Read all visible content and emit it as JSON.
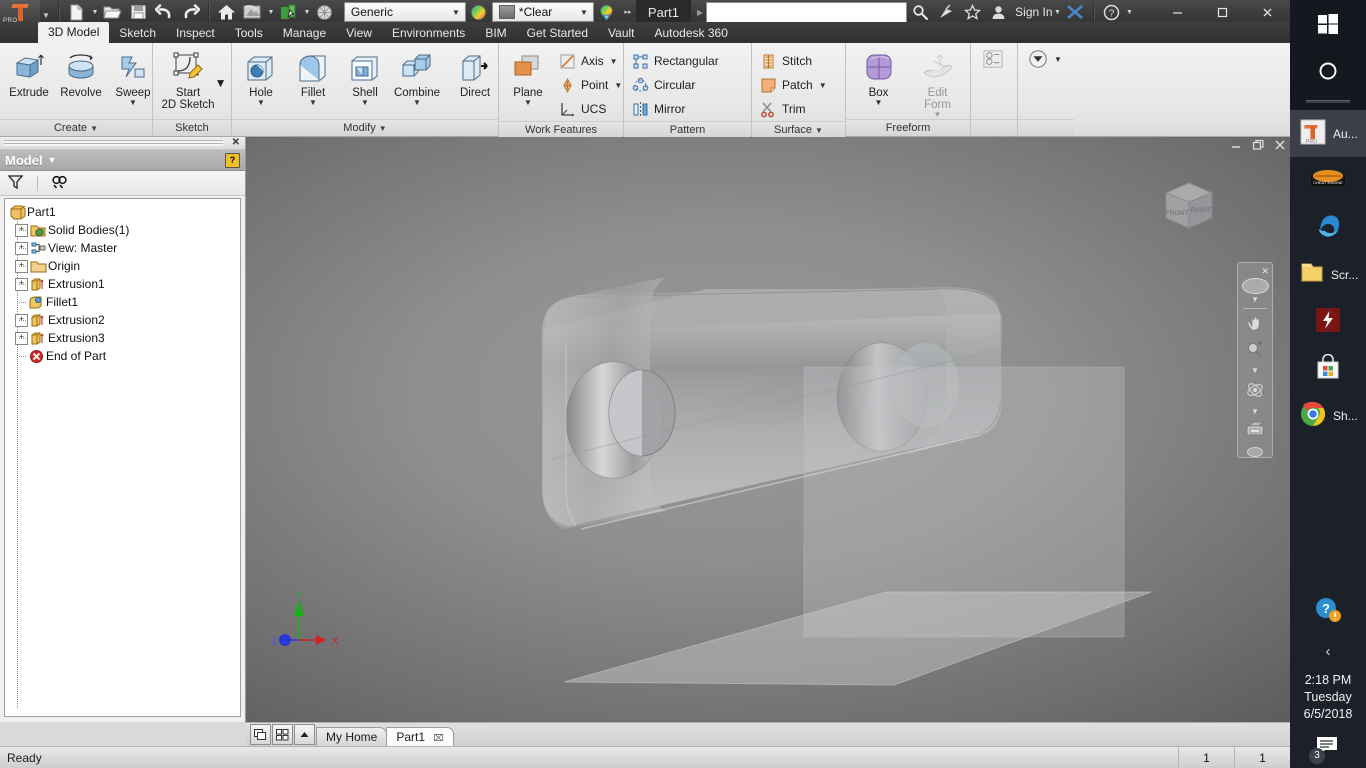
{
  "app": {
    "product": "Autodesk Inventor Professional",
    "document_title": "Part1",
    "pro_tag": "PRO"
  },
  "quick_access": {
    "items": [
      {
        "name": "new",
        "label": "New",
        "has_dropdown": true
      },
      {
        "name": "open",
        "label": "Open",
        "has_dropdown": false
      },
      {
        "name": "save",
        "label": "Save",
        "has_dropdown": false
      },
      {
        "name": "undo",
        "label": "Undo",
        "has_dropdown": false
      },
      {
        "name": "redo",
        "label": "Redo",
        "has_dropdown": false
      },
      {
        "name": "home",
        "label": "Home",
        "has_dropdown": false
      },
      {
        "name": "return",
        "label": "Return",
        "has_dropdown": true
      },
      {
        "name": "update",
        "label": "Update",
        "has_dropdown": true
      },
      {
        "name": "material-browser",
        "label": "Material Browser",
        "has_dropdown": false
      }
    ],
    "material_value": "Generic",
    "appearance_value": "*Clear",
    "overflow_label": "▸▸"
  },
  "titlebar": {
    "search_placeholder": "",
    "search_value": "",
    "sign_in_label": "Sign In",
    "help_label": "?",
    "icons": [
      "search-icon",
      "satellite-icon",
      "favorites-star-icon",
      "user-icon",
      "exchange-icon",
      "help-icon"
    ],
    "window_buttons": [
      "minimize",
      "maximize",
      "close"
    ]
  },
  "ribbon_tabs": [
    {
      "label": "3D Model",
      "active": true
    },
    {
      "label": "Sketch",
      "active": false
    },
    {
      "label": "Inspect",
      "active": false
    },
    {
      "label": "Tools",
      "active": false
    },
    {
      "label": "Manage",
      "active": false
    },
    {
      "label": "View",
      "active": false
    },
    {
      "label": "Environments",
      "active": false
    },
    {
      "label": "BIM",
      "active": false
    },
    {
      "label": "Get Started",
      "active": false
    },
    {
      "label": "Vault",
      "active": false
    },
    {
      "label": "Autodesk 360",
      "active": false
    }
  ],
  "ribbon_panels": [
    {
      "name": "create",
      "label": "Create",
      "has_dropdown": true,
      "buttons": [
        {
          "label": "Extrude",
          "icon": "extrude-icon",
          "dropdown": false,
          "disabled": false
        },
        {
          "label": "Revolve",
          "icon": "revolve-icon",
          "dropdown": false,
          "disabled": false
        },
        {
          "label": "Sweep",
          "icon": "sweep-icon",
          "dropdown": true,
          "disabled": false
        }
      ]
    },
    {
      "name": "sketch",
      "label": "Sketch",
      "has_dropdown": false,
      "buttons": [
        {
          "label": "Start\n2D Sketch",
          "icon": "start-2d-sketch-icon",
          "dropdown": true,
          "disabled": false
        }
      ]
    },
    {
      "name": "modify",
      "label": "Modify",
      "has_dropdown": true,
      "buttons": [
        {
          "label": "Hole",
          "icon": "hole-icon",
          "dropdown": true,
          "disabled": false
        },
        {
          "label": "Fillet",
          "icon": "fillet-icon",
          "dropdown": true,
          "disabled": false
        },
        {
          "label": "Shell",
          "icon": "shell-icon",
          "dropdown": true,
          "disabled": false
        },
        {
          "label": "Combine",
          "icon": "combine-icon",
          "dropdown": true,
          "disabled": false
        },
        {
          "label": "Direct",
          "icon": "direct-edit-icon",
          "dropdown": false,
          "disabled": false
        }
      ]
    },
    {
      "name": "work-features",
      "label": "Work Features",
      "has_dropdown": false,
      "buttons": [
        {
          "label": "Plane",
          "icon": "work-plane-icon",
          "dropdown": true,
          "disabled": false
        }
      ],
      "small_items": [
        {
          "label": "Axis",
          "icon": "work-axis-icon",
          "dropdown": true
        },
        {
          "label": "Point",
          "icon": "work-point-icon",
          "dropdown": true
        },
        {
          "label": "UCS",
          "icon": "ucs-icon",
          "dropdown": false
        }
      ]
    },
    {
      "name": "pattern",
      "label": "Pattern",
      "has_dropdown": false,
      "small_items": [
        {
          "label": "Rectangular",
          "icon": "rectangular-pattern-icon",
          "dropdown": false
        },
        {
          "label": "Circular",
          "icon": "circular-pattern-icon",
          "dropdown": false
        },
        {
          "label": "Mirror",
          "icon": "mirror-icon",
          "dropdown": false
        }
      ]
    },
    {
      "name": "surface",
      "label": "Surface",
      "has_dropdown": true,
      "small_items": [
        {
          "label": "Stitch",
          "icon": "stitch-icon",
          "dropdown": false
        },
        {
          "label": "Patch",
          "icon": "patch-icon",
          "dropdown": true
        },
        {
          "label": "Trim",
          "icon": "trim-icon",
          "dropdown": false
        }
      ]
    },
    {
      "name": "freeform",
      "label": "Freeform",
      "has_dropdown": false,
      "buttons": [
        {
          "label": "Box",
          "icon": "freeform-box-icon",
          "dropdown": true,
          "disabled": false
        },
        {
          "label": "Edit\nForm",
          "icon": "edit-form-icon",
          "dropdown": true,
          "disabled": true
        }
      ]
    },
    {
      "name": "convert",
      "label": "",
      "has_dropdown": false,
      "small_items": [
        {
          "label": "",
          "icon": "convert-icon",
          "dropdown": false
        }
      ]
    },
    {
      "name": "explore",
      "label": "",
      "has_dropdown": false,
      "small_items": [
        {
          "label": "",
          "icon": "explore-dropdown-icon",
          "dropdown": true
        }
      ]
    }
  ],
  "browser": {
    "panel_title": "Model",
    "help_glyph": "?",
    "close_glyph": "✕",
    "tools": [
      {
        "name": "filter-icon",
        "label": "Filter"
      },
      {
        "name": "find-icon",
        "label": "Find"
      }
    ],
    "tree": [
      {
        "label": "Part1",
        "icon": "part-icon",
        "indent": 0,
        "expandable": false
      },
      {
        "label": "Solid Bodies(1)",
        "icon": "solid-bodies-folder-icon",
        "indent": 1,
        "expandable": true
      },
      {
        "label": "View: Master",
        "icon": "view-master-icon",
        "indent": 1,
        "expandable": true
      },
      {
        "label": "Origin",
        "icon": "origin-folder-icon",
        "indent": 1,
        "expandable": true
      },
      {
        "label": "Extrusion1",
        "icon": "extrusion-icon",
        "indent": 1,
        "expandable": true
      },
      {
        "label": "Fillet1",
        "icon": "fillet-feature-icon",
        "indent": 1,
        "expandable": false
      },
      {
        "label": "Extrusion2",
        "icon": "extrusion-icon",
        "indent": 1,
        "expandable": true
      },
      {
        "label": "Extrusion3",
        "icon": "extrusion-icon",
        "indent": 1,
        "expandable": true
      },
      {
        "label": "End of Part",
        "icon": "end-of-part-icon",
        "indent": 1,
        "expandable": false
      }
    ]
  },
  "viewport": {
    "document_window_buttons": [
      "minimize",
      "restore",
      "close"
    ],
    "viewcube": {
      "front_label": "FRONT",
      "right_label": "RIGHT"
    },
    "axis_triad": {
      "x_label": "X",
      "y_label": "Y",
      "z_label": "Z",
      "x_color": "#d42020",
      "y_color": "#18b018",
      "z_color": "#2a38d8"
    },
    "navigation_tools": [
      {
        "name": "steering-wheel-icon",
        "label": "Full Navigation Wheel"
      },
      {
        "name": "pan-icon",
        "label": "Pan"
      },
      {
        "name": "zoom-icon",
        "label": "Zoom"
      },
      {
        "name": "orbit-icon",
        "label": "Orbit"
      },
      {
        "name": "look-at-icon",
        "label": "Look At"
      }
    ],
    "model_description": "Translucent grey rectangular block with rounded ends and two circular through holes"
  },
  "document_tabs": {
    "buttons": [
      {
        "name": "cascade-windows-button",
        "label": "Cascade"
      },
      {
        "name": "tile-windows-button",
        "label": "Tile"
      },
      {
        "name": "scroll-up-button",
        "label": "▲"
      }
    ],
    "tabs": [
      {
        "label": "My Home",
        "active": false,
        "closable": false
      },
      {
        "label": "Part1",
        "active": true,
        "closable": true
      }
    ],
    "close_glyph": "⌧"
  },
  "status_bar": {
    "message": "Ready",
    "cells": [
      "1",
      "1"
    ]
  },
  "taskbar": {
    "start_label": "Start",
    "cortana_label": "Cortana",
    "items": [
      {
        "name": "taskbar-item-inventor",
        "label": "Au...",
        "icon": "inventor-icon",
        "active": true,
        "running": true
      },
      {
        "name": "taskbar-item-cheat-engine",
        "label": "",
        "icon": "cheat-engine-icon",
        "active": false,
        "running": false
      },
      {
        "name": "taskbar-item-edge",
        "label": "",
        "icon": "edge-icon",
        "active": false,
        "running": false
      },
      {
        "name": "taskbar-item-explorer",
        "label": "Scr...",
        "icon": "folder-icon",
        "active": false,
        "running": true
      },
      {
        "name": "taskbar-item-flash",
        "label": "",
        "icon": "flash-icon",
        "active": false,
        "running": false
      },
      {
        "name": "taskbar-item-store",
        "label": "",
        "icon": "store-icon",
        "active": false,
        "running": false
      },
      {
        "name": "taskbar-item-chrome",
        "label": "Sh...",
        "icon": "chrome-icon",
        "active": false,
        "running": true
      }
    ],
    "tray": {
      "help_icon": "help-alert-icon",
      "expand_glyph": "‹"
    },
    "clock": {
      "time": "2:18 PM",
      "day": "Tuesday",
      "date": "6/5/2018"
    },
    "notifications": {
      "count": "3",
      "icon": "action-center-icon"
    }
  }
}
